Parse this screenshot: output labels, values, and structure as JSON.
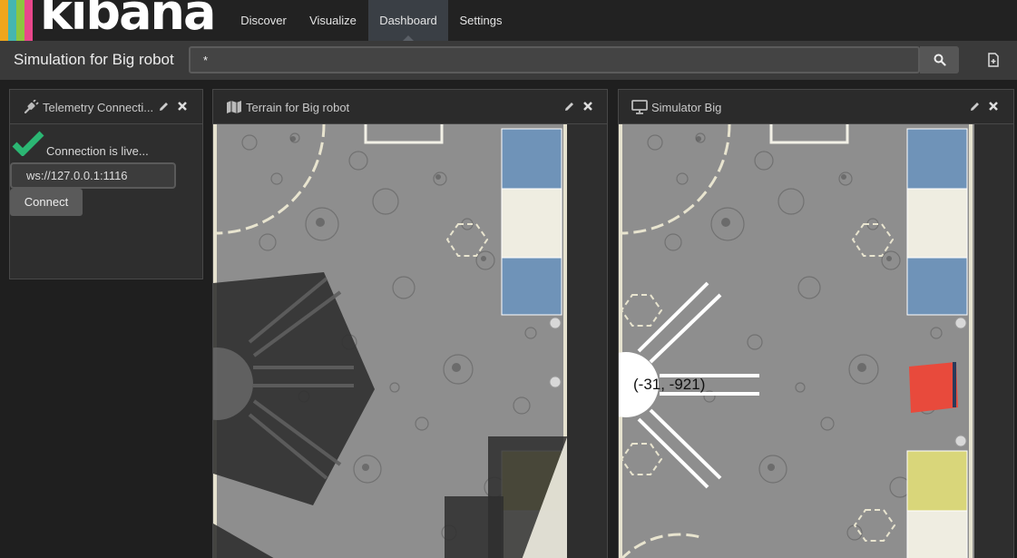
{
  "nav": {
    "logo_text": "kibana",
    "items": [
      {
        "label": "Discover"
      },
      {
        "label": "Visualize"
      },
      {
        "label": "Dashboard"
      },
      {
        "label": "Settings"
      }
    ],
    "active_item": "Dashboard"
  },
  "toolbar": {
    "dashboard_title": "Simulation for Big robot",
    "search_value": "*"
  },
  "panels": {
    "telemetry": {
      "title": "Telemetry Connecti...",
      "status_text": "Connection is live...",
      "ws_url": "ws://127.0.0.1:1116",
      "connect_label": "Connect"
    },
    "terrain": {
      "title": "Terrain for Big robot"
    },
    "simulator": {
      "title": "Simulator Big",
      "robot_coords": "(-31, -921)"
    }
  },
  "colors": {
    "logo_stripes": [
      "#f0a61c",
      "#45b6b0",
      "#8dc63f",
      "#e8478b"
    ],
    "check": "#2bb673",
    "zone_blue": "#6f93b8",
    "zone_cream": "#efede1",
    "zone_yellow": "#d9d67a",
    "robot_red": "#e84a3c"
  }
}
